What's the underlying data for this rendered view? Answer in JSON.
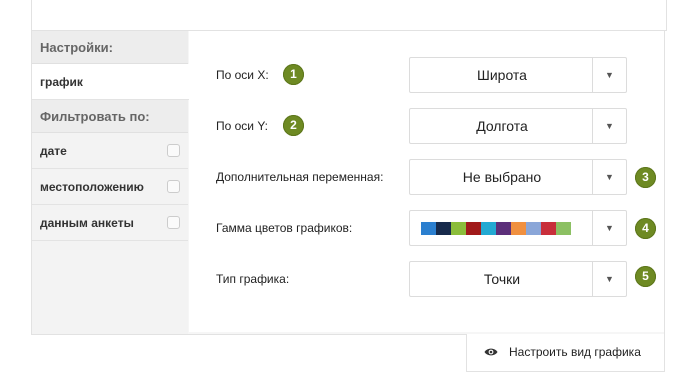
{
  "sidebar": {
    "settings_header": "Настройки:",
    "chart_item": "график",
    "filter_header": "Фильтровать по:",
    "filters": [
      {
        "label": "дате",
        "checked": false
      },
      {
        "label": "местоположению",
        "checked": false
      },
      {
        "label": "данным анкеты",
        "checked": false
      }
    ]
  },
  "rows": [
    {
      "label": "По оси X:",
      "value": "Широта",
      "step": "1"
    },
    {
      "label": "По оси Y:",
      "value": "Долгота",
      "step": "2"
    },
    {
      "label": "Дополнительная переменная:",
      "value": "Не выбрано",
      "step": "3"
    },
    {
      "label": "Гамма цветов графиков:",
      "value": "",
      "step": "4",
      "palette": [
        "#2b7fcf",
        "#172a4b",
        "#8bbd3b",
        "#a11a1a",
        "#23a9d2",
        "#5c2f7a",
        "#f09040",
        "#8aa6d8",
        "#c82f3b",
        "#8cc063"
      ]
    },
    {
      "label": "Тип графика:",
      "value": "Точки",
      "step": "5"
    }
  ],
  "icons": {
    "dropdown": "▼",
    "footer": "eye-icon"
  },
  "footer": {
    "button_label": "Настроить вид графика"
  },
  "colors": {
    "badge": "#6e8a23"
  }
}
